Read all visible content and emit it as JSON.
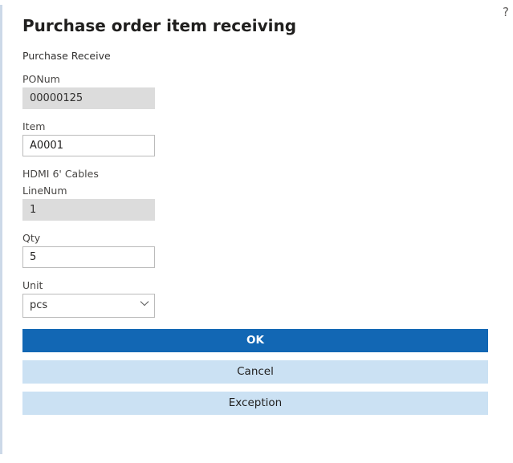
{
  "help_icon": "?",
  "page_title": "Purchase order item receiving",
  "section_label": "Purchase Receive",
  "fields": {
    "ponum": {
      "label": "PONum",
      "value": "00000125"
    },
    "item": {
      "label": "Item",
      "value": "A0001",
      "description": "HDMI 6' Cables"
    },
    "linenum": {
      "label": "LineNum",
      "value": "1"
    },
    "qty": {
      "label": "Qty",
      "value": "5"
    },
    "unit": {
      "label": "Unit",
      "value": "pcs"
    }
  },
  "buttons": {
    "ok": "OK",
    "cancel": "Cancel",
    "exception": "Exception"
  }
}
